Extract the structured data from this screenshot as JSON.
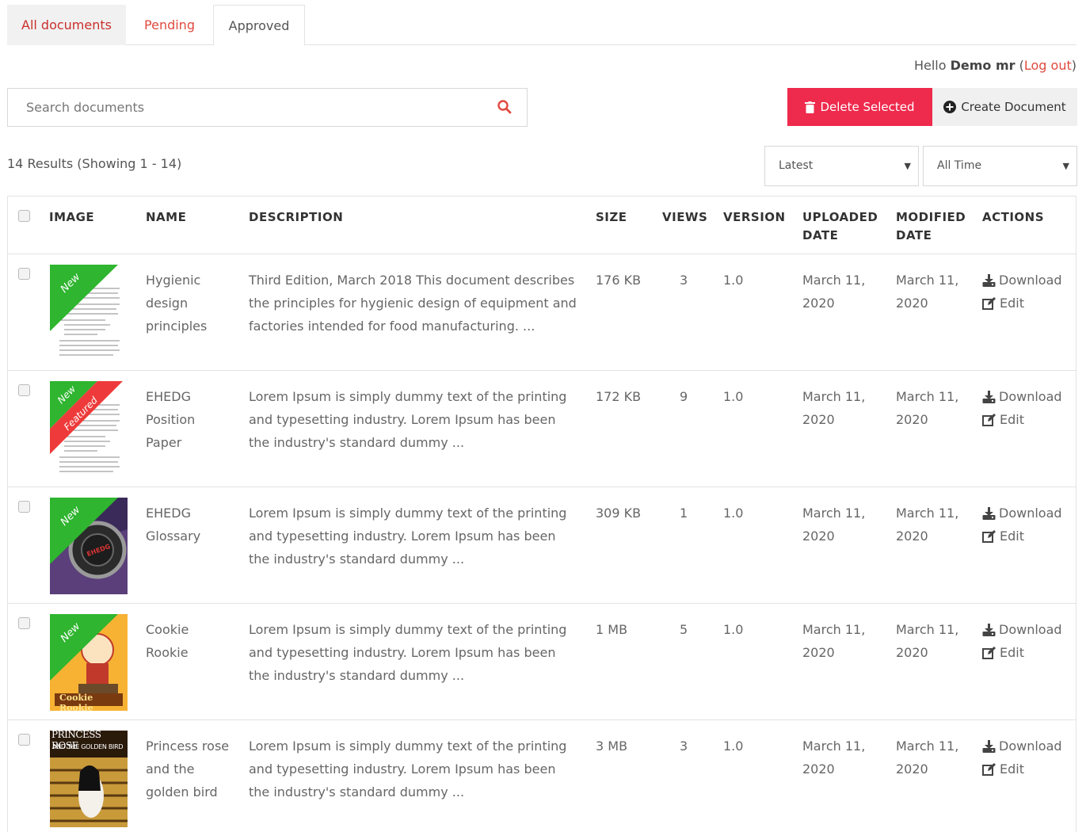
{
  "tabs": [
    {
      "label": "All documents"
    },
    {
      "label": "Pending"
    },
    {
      "label": "Approved"
    }
  ],
  "user": {
    "greeting": "Hello",
    "name": "Demo mr",
    "logout_label": "Log out"
  },
  "search": {
    "placeholder": "Search documents"
  },
  "buttons": {
    "delete_label": "Delete Selected",
    "create_label": "Create Document"
  },
  "results_text": "14 Results (Showing 1 - 14)",
  "filters": {
    "sort_selected": "Latest",
    "time_selected": "All Time"
  },
  "table": {
    "headers": {
      "image": "IMAGE",
      "name": "NAME",
      "description": "DESCRIPTION",
      "size": "SIZE",
      "views": "VIEWS",
      "version": "VERSION",
      "uploaded_1": "UPLOADED",
      "uploaded_2": "DATE",
      "modified_1": "MODIFIED",
      "modified_2": "DATE",
      "actions": "ACTIONS"
    },
    "action_labels": {
      "download": "Download",
      "edit": "Edit"
    },
    "badges": {
      "new": "New",
      "featured": "Featured"
    },
    "rows": [
      {
        "name_lines": [
          "Hygienic",
          "design",
          "principles"
        ],
        "description_lines": [
          "Third Edition, March 2018 This document describes",
          "the principles for hygienic design of equipment and",
          "factories intended for food manufacturing. ..."
        ],
        "size": "176 KB",
        "views": "3",
        "version": "1.0",
        "uploaded": [
          "March 11,",
          "2020"
        ],
        "modified": [
          "March 11,",
          "2020"
        ],
        "thumb": "document-page",
        "new": true,
        "featured": false
      },
      {
        "name_lines": [
          "EHEDG",
          "Position",
          "Paper"
        ],
        "description_lines": [
          "Lorem Ipsum is simply dummy text of the printing",
          "and typesetting industry. Lorem Ipsum has been",
          "the industry's standard dummy ..."
        ],
        "size": "172 KB",
        "views": "9",
        "version": "1.0",
        "uploaded": [
          "March 11,",
          "2020"
        ],
        "modified": [
          "March 11,",
          "2020"
        ],
        "thumb": "document-page",
        "new": true,
        "featured": true
      },
      {
        "name_lines": [
          "EHEDG",
          "Glossary"
        ],
        "description_lines": [
          "Lorem Ipsum is simply dummy text of the printing",
          "and typesetting industry. Lorem Ipsum has been",
          "the industry's standard dummy ..."
        ],
        "size": "309 KB",
        "views": "1",
        "version": "1.0",
        "uploaded": [
          "March 11,",
          "2020"
        ],
        "modified": [
          "March 11,",
          "2020"
        ],
        "thumb": "ehedg-logo",
        "logo_text": "EHEDG",
        "new": true,
        "featured": false
      },
      {
        "name_lines": [
          "Cookie",
          "Rookie"
        ],
        "description_lines": [
          "Lorem Ipsum is simply dummy text of the printing",
          "and typesetting industry. Lorem Ipsum has been",
          "the industry's standard dummy ..."
        ],
        "size": "1 MB",
        "views": "5",
        "version": "1.0",
        "uploaded": [
          "March 11,",
          "2020"
        ],
        "modified": [
          "March 11,",
          "2020"
        ],
        "thumb": "cookie-cover",
        "cover_text": "Cookie Rookie",
        "new": true,
        "featured": false
      },
      {
        "name_lines": [
          "Princess rose",
          "and the",
          "golden bird"
        ],
        "description_lines": [
          "Lorem Ipsum is simply dummy text of the printing",
          "and typesetting industry. Lorem Ipsum has been",
          "the industry's standard dummy ..."
        ],
        "size": "3 MB",
        "views": "3",
        "version": "1.0",
        "uploaded": [
          "March 11,",
          "2020"
        ],
        "modified": [
          "March 11,",
          "2020"
        ],
        "thumb": "princess-cover",
        "cover_text_1": "PRINCESS ROSE",
        "cover_text_2": "AND THE GOLDEN BIRD",
        "new": false,
        "featured": false
      }
    ]
  },
  "colors": {
    "accent": "#e04a3f",
    "delete": "#ee2a4d",
    "badge_new": "#2fb52f",
    "badge_featured": "#ee3a3a"
  }
}
